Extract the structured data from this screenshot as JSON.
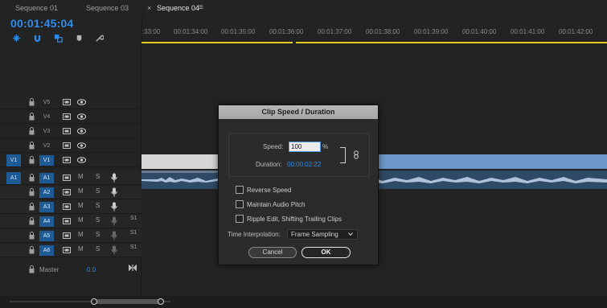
{
  "tabs": [
    {
      "label": "Sequence 01"
    },
    {
      "label": "Sequence 03"
    },
    {
      "label": "Sequence 04"
    }
  ],
  "tab_close": "×",
  "tab_menu": "≡",
  "timecode": "00:01:45:04",
  "ruler": {
    "labels": [
      ":33:00",
      "00:01:34:00",
      "00:01:35:00",
      "00:01:36:00",
      "00:01:37:00",
      "00:01:38:00",
      "00:01:39:00",
      "00:01:40:00",
      "00:01:41:00",
      "00:01:42:00"
    ]
  },
  "tracks": {
    "video": [
      {
        "name": "V5"
      },
      {
        "name": "V4"
      },
      {
        "name": "V3"
      },
      {
        "name": "V2"
      },
      {
        "name": "V1",
        "source": "V1"
      }
    ],
    "audio": [
      {
        "name": "A1",
        "source": "A1",
        "m": "M",
        "s": "S",
        "extra": ""
      },
      {
        "name": "A2",
        "m": "M",
        "s": "S",
        "extra": ""
      },
      {
        "name": "A3",
        "m": "M",
        "s": "S",
        "extra": ""
      },
      {
        "name": "A4",
        "m": "M",
        "s": "S",
        "extra": "S1"
      },
      {
        "name": "A5",
        "m": "M",
        "s": "S",
        "extra": "S1"
      },
      {
        "name": "A6",
        "m": "M",
        "s": "S",
        "extra": "S1"
      }
    ],
    "master_label": "Master",
    "master_value": "0.0"
  },
  "dialog": {
    "title": "Clip Speed / Duration",
    "speed_label": "Speed:",
    "speed_value": "100",
    "speed_unit": "%",
    "duration_label": "Duration:",
    "duration_value": "00:00:02:22",
    "checkboxes": [
      {
        "label": "Reverse Speed",
        "checked": false
      },
      {
        "label": "Maintain Audio Pitch",
        "checked": false
      },
      {
        "label": "Ripple Edit, Shifting Trailing Clips",
        "checked": false
      }
    ],
    "interp_label": "Time Interpolation:",
    "interp_value": "Frame Sampling",
    "cancel_label": "Cancel",
    "ok_label": "OK"
  },
  "colors": {
    "accent": "#2d8ceb",
    "track_target": "#1e5a93",
    "playhead_range": "#e2cd1e",
    "clip_video": "#6d97c9",
    "clip_audio": "#2f4a66"
  }
}
